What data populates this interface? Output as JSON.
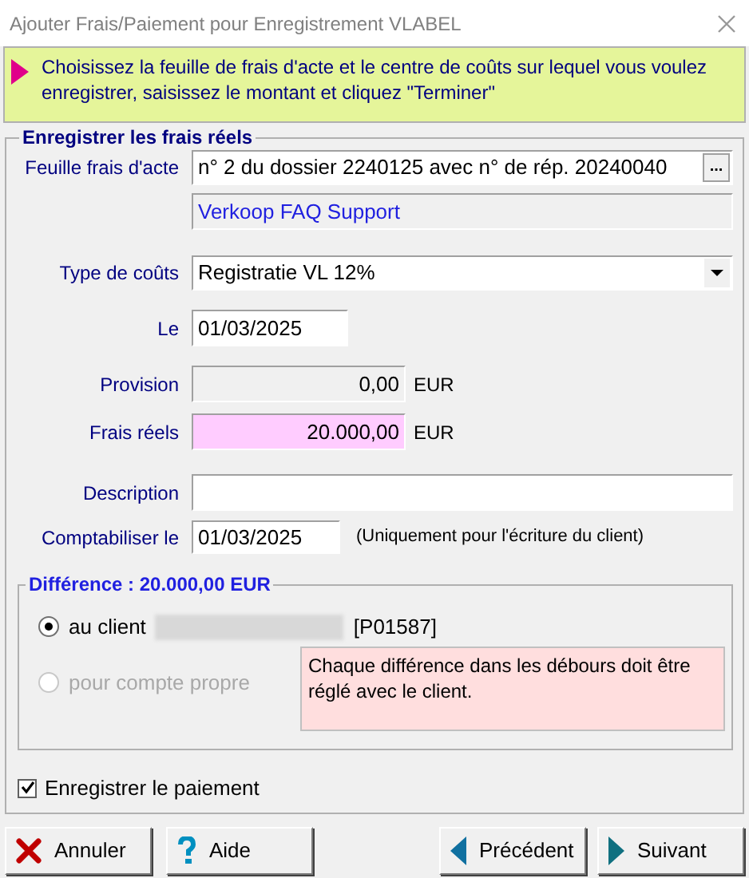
{
  "window": {
    "title": "Ajouter Frais/Paiement pour Enregistrement VLABEL"
  },
  "banner": {
    "text": "Choisissez la feuille de frais d'acte et le centre de coûts sur lequel vous voulez enregistrer, saisissez le montant et cliquez \"Terminer\""
  },
  "group": {
    "title": "Enregistrer les frais réels"
  },
  "sheet": {
    "label": "Feuille frais d'acte",
    "value": "n° 2 du dossier 2240125 avec n° de rép. 20240040",
    "button": "...",
    "info": "Verkoop FAQ Support"
  },
  "cost_type": {
    "label": "Type de coûts",
    "value": "Registratie VL 12%"
  },
  "date": {
    "label": "Le",
    "value": "01/03/2025"
  },
  "provision": {
    "label": "Provision",
    "value": "0,00",
    "unit": "EUR"
  },
  "actual": {
    "label": "Frais réels",
    "value": "20.000,00",
    "unit": "EUR"
  },
  "description": {
    "label": "Description"
  },
  "booking": {
    "label": "Comptabiliser le",
    "value": "01/03/2025",
    "note": "(Uniquement pour l'écriture du client)"
  },
  "difference": {
    "title": "Différence : 20.000,00 EUR",
    "options": [
      {
        "label": "au client",
        "suffix": "[P01587]",
        "selected": true,
        "disabled": false
      },
      {
        "label": "pour compte propre",
        "selected": false,
        "disabled": true
      }
    ],
    "note": "Chaque différence dans les débours doit être réglé avec le client."
  },
  "register_payment": {
    "label": "Enregistrer le paiement",
    "checked": true
  },
  "buttons": [
    {
      "label": "Annuler",
      "kind": "cancel"
    },
    {
      "label": "Aide",
      "kind": "help"
    },
    {
      "label": "Précédent",
      "kind": "back"
    },
    {
      "label": "Suivant",
      "kind": "next"
    }
  ]
}
